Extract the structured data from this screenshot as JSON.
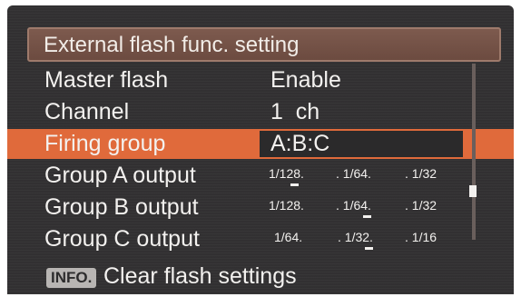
{
  "title": "External flash func. setting",
  "rows": [
    {
      "label": "Master flash",
      "value": "Enable"
    },
    {
      "label": "Channel",
      "value": "1  ch"
    },
    {
      "label": "Firing group",
      "value": "A:B:C"
    },
    {
      "label": "Group A output",
      "scale": [
        "1/128.",
        ". 1/64.",
        ". 1/32"
      ]
    },
    {
      "label": "Group B output",
      "scale": [
        "1/128.",
        ". 1/64.",
        ". 1/32"
      ]
    },
    {
      "label": "Group C output",
      "scale": [
        "1/64.",
        ". 1/32.",
        ". 1/16"
      ]
    }
  ],
  "selected_row": "Firing group",
  "output_levels": {
    "group_a": "1/128",
    "group_b": "1/64",
    "group_c": "1/32"
  },
  "footer": {
    "badge": "INFO.",
    "text": "Clear flash settings"
  },
  "colors": {
    "background": "#333233",
    "title_bar": "#7d5a4e",
    "selection": "#e06a3b",
    "text": "#f3f1ef"
  }
}
